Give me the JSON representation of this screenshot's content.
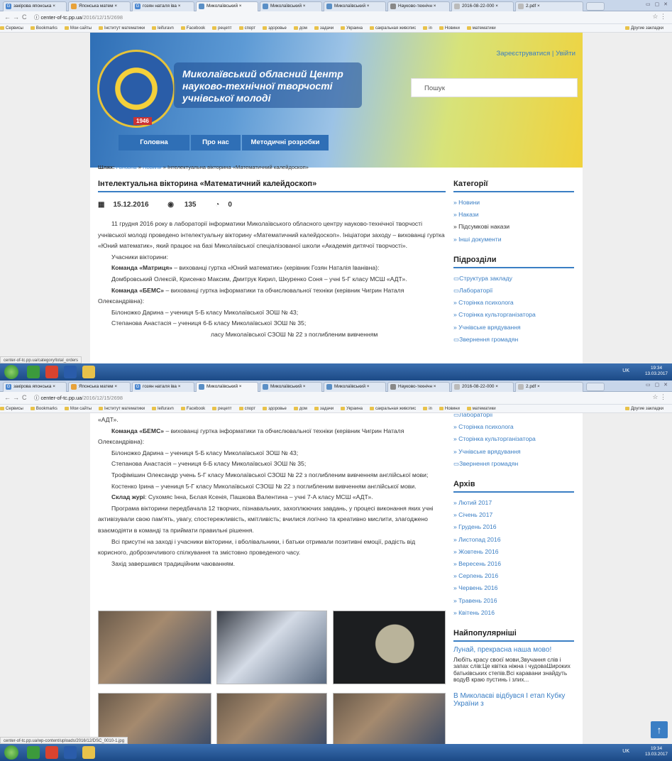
{
  "browser": {
    "tabs": [
      {
        "label": "закірова японська ×"
      },
      {
        "label": "Японська матем ×"
      },
      {
        "label": "гозян наталя іва ×"
      },
      {
        "label": "Миколаївський ×"
      },
      {
        "label": "Миколаївський ×"
      },
      {
        "label": "Миколаївський ×"
      },
      {
        "label": "Науково-технічн ×"
      },
      {
        "label": "2016-08-22-000 ×"
      },
      {
        "label": "2.pdf ×"
      }
    ],
    "url_host": "center-of-tc.pp.ua",
    "url_path": "/2016/12/15/2698",
    "bookmarks": [
      "Сервисы",
      "Bookmarks",
      "Мои сайты",
      "Інститут математики",
      "leifuravn",
      "Facebook",
      "рецепт",
      "спорт",
      "здоровье",
      "дом",
      "задачи",
      "Украина",
      "сакральная живопис",
      "in",
      "Новини",
      "математики"
    ],
    "other_bookmarks": "Другие закладки"
  },
  "header": {
    "reg_links": "Зареєструватися | Увійти",
    "site_title_1": "Миколаївський обласний Центр",
    "site_title_2": "науково-технічної творчості",
    "site_title_3": "учнівської молоді",
    "logo_year": "1946",
    "search_placeholder": "Пошук",
    "menu": [
      "Головна",
      "Про нас",
      "Методичні розробки"
    ]
  },
  "breadcrumb": {
    "label": "Шлях:",
    "home": "Головна",
    "sep1": " » ",
    "news": "Новини",
    "sep2": " » ",
    "current": "Інтелектуальна вікторина «Математичний калейдоскоп»"
  },
  "article": {
    "title": "Інтелектуальна вікторина «Математичний калейдоскоп»",
    "date": "15.12.2016",
    "views": "135",
    "comments": "0",
    "p1": "11 грудня 2016 року в лабораторії інформатики Миколаївського обласного центру науково-технічної творчості учнівської молоді проведено інтелектуальну вікторину «Математичний калейдоскоп». Ініціатори заходу – вихованці гуртка «Юний математик», який працює на базі Миколаївської спеціалізованої школи «Академія дитячої творчості».",
    "p2": "Учасники вікторини:",
    "p3_b": "Команда «Матриця»",
    "p3": " – вихованці гуртка «Юний математик» (керівник Гозян Наталія Іванівна):",
    "p4": "Домбровський Олексій, Крисенко Максим, Дмитрук Кирил, Шкуренко Соня – учні 5-Г класу МСШ «АДТ».",
    "p5_b": "Команда «БЕМС»",
    "p5": " – вихованці гуртка інформатики та обчислювальної техніки (керівник Чигрин Наталя Олександрівна):",
    "p6": "Білоножко Дарина – учениця 5-Б класу Миколаївської ЗОШ № 43;",
    "p7": "Степанова Анастасія – учениця 6-Б класу Миколаївської ЗОШ № 35;",
    "p8": "Трофімішин Олександр учень 5-Г класу Миколаївської СЗОШ № 22 з поглибленим вивченням англійської мови;",
    "p8_cut": "ласу Миколаївської СЗОШ № 22 з поглибленим вивченням",
    "p9": "Костенко Ірина – учениця 5-Г класу Миколаївської СЗОШ № 22 з поглибленим вивченням англійської мови.",
    "p10_b": "Склад журі",
    "p10": ": Сухомяс Інна, Бєлая Ксенія, Пашкова Валентина – учні 7-А класу МСШ «АДТ».",
    "p11": "Програма вікторини передбачала 12 творчих, пізнавальних, захоплюючих завдань, у процесі виконання яких учні активізували свою пам'ять, увагу, спостережливість, кмітливість; вчилися логічно та креативно мислити, злагоджено взаємодіяти в команді та приймати правильні рішення.",
    "p12": "Всі присутні на заході і учасники вікторини, і вболівальники, і батьки отримали позитивні емоції, радість від корисного, доброзичливого спілкування та змістовно проведеного часу.",
    "p13": "Захід завершився традиційним чаюванням.",
    "p4_tail": "«АДТ»."
  },
  "sidebar": {
    "cat_title": "Категорії",
    "categories": [
      "» Новини",
      "» Накази",
      "» Підсумкові накази",
      "» Інші документи"
    ],
    "sub_title": "Підрозділи",
    "subdivisions": [
      "Структура закладу",
      "Лабораторії",
      "» Сторінка психолога",
      "» Сторінка культорганізатора",
      "» Учнівське врядування",
      "Звернення громадян"
    ],
    "arch_title": "Архів",
    "archive": [
      "» Лютий 2017",
      "» Січень 2017",
      "» Грудень 2016",
      "» Листопад 2016",
      "» Жовтень 2016",
      "» Вересень 2016",
      "» Серпень 2016",
      "» Червень 2016",
      "» Травень 2016",
      "» Квітень 2016"
    ],
    "pop_title": "Найпопулярніші",
    "pop1_title": "Лунай, прекрасна наша мово!",
    "pop1_text": "Любіть красу своєї мови,Звучання слів і запах слів:Це квітка ніжна і чудоваШироких батьківських степів.Всі каравани знайдуть водуВ краю пустинь і злих...",
    "pop2_title": "В Миколаєві відбувся І етап Кубку України з"
  },
  "status": {
    "shot1": "center-of-tc.pp.ua/category/total_orders",
    "shot2": "center-of-tc.pp.ua/wp-content/uploads/2016/12/DSC_0010-1.jpg"
  },
  "taskbar": {
    "lang": "UK",
    "time": "19:34",
    "date": "13.03.2017"
  },
  "icons": {
    "calendar": "calendar-icon",
    "eye": "eye-icon",
    "comment": "comment-icon",
    "up": "arrow-up-icon"
  }
}
